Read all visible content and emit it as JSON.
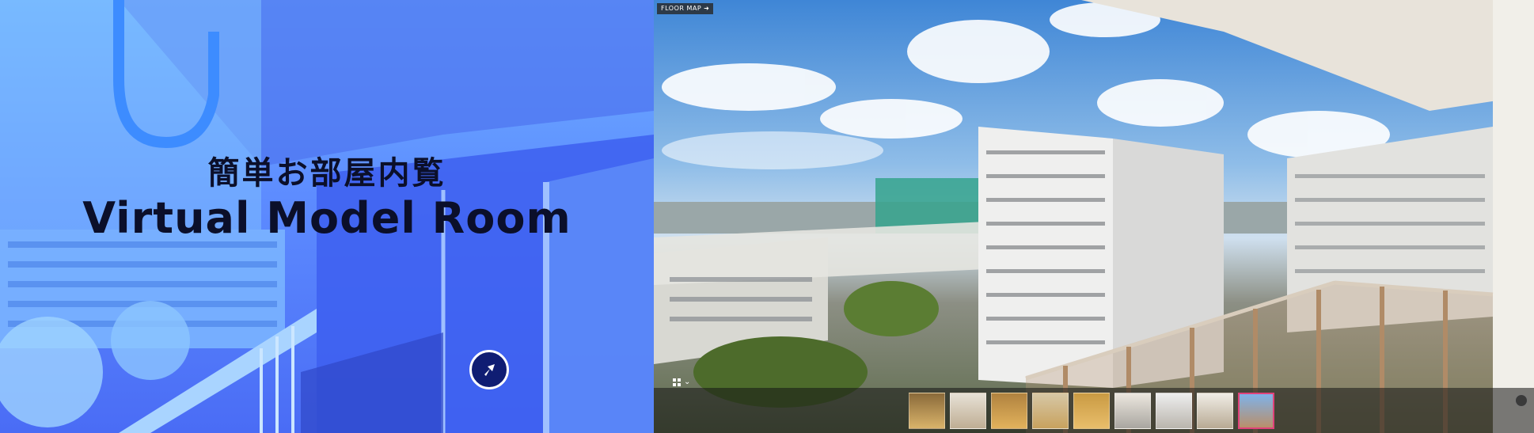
{
  "promo": {
    "title_jp": "簡単お部屋内覧",
    "title_en": "Virtual Model Room",
    "nav_icon": "arrow-up-right-icon",
    "accent_color": "#5d8cff"
  },
  "viewer": {
    "floor_map_label": "FLOOR MAP",
    "floor_map_icon": "external-arrow-icon",
    "menu_icon": "grid-icon",
    "menu_chevron": "chevron-down-icon",
    "settings_icon": "gear-icon",
    "active_color": "#e0427a",
    "thumbnails": [
      {
        "name": "room-1",
        "label": ""
      },
      {
        "name": "room-2",
        "label": ""
      },
      {
        "name": "room-3",
        "label": ""
      },
      {
        "name": "room-4",
        "label": ""
      },
      {
        "name": "room-5",
        "label": ""
      },
      {
        "name": "room-6",
        "label": ""
      },
      {
        "name": "room-7",
        "label": ""
      },
      {
        "name": "room-8",
        "label": ""
      },
      {
        "name": "balcony",
        "label": ""
      }
    ],
    "active_thumbnail_index": 8
  }
}
